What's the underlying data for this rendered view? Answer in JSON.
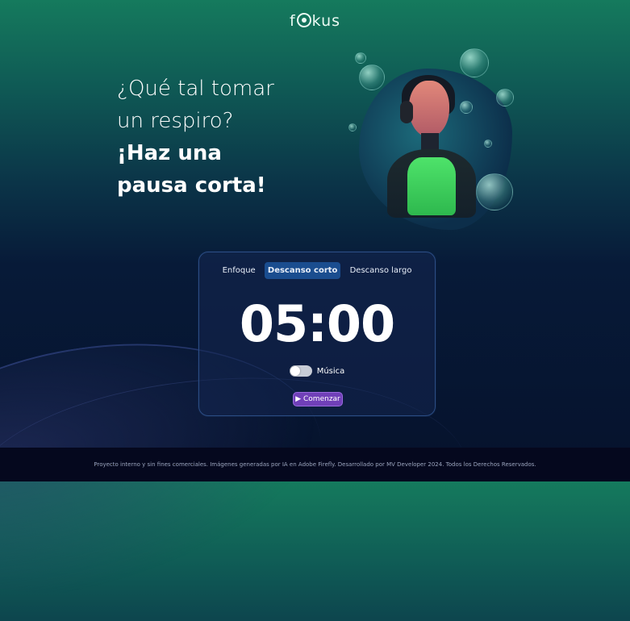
{
  "header": {
    "logo_text_left": "f",
    "logo_text_right": "kus"
  },
  "hero": {
    "line1": "¿Qué tal tomar",
    "line2": "un respiro?",
    "line3": "¡Haz una",
    "line4": "pausa corta!"
  },
  "timer_card": {
    "tabs": [
      {
        "label": "Enfoque",
        "active": false
      },
      {
        "label": "Descanso corto",
        "active": true
      },
      {
        "label": "Descanso largo",
        "active": false
      }
    ],
    "time": "05:00",
    "music_label": "Música",
    "music_on": false,
    "start_label": "Comenzar",
    "start_icon": "play-icon"
  },
  "footer": {
    "text": "Proyecto interno y sin fines comerciales. Imágenes generadas por IA en Adobe Firefly. Desarrollado por MV Developer 2024. Todos los Derechos Reservados."
  },
  "colors": {
    "active_tab": "#1a4d8f",
    "start_button": "#7040b8",
    "card_border": "#2b4d84"
  }
}
